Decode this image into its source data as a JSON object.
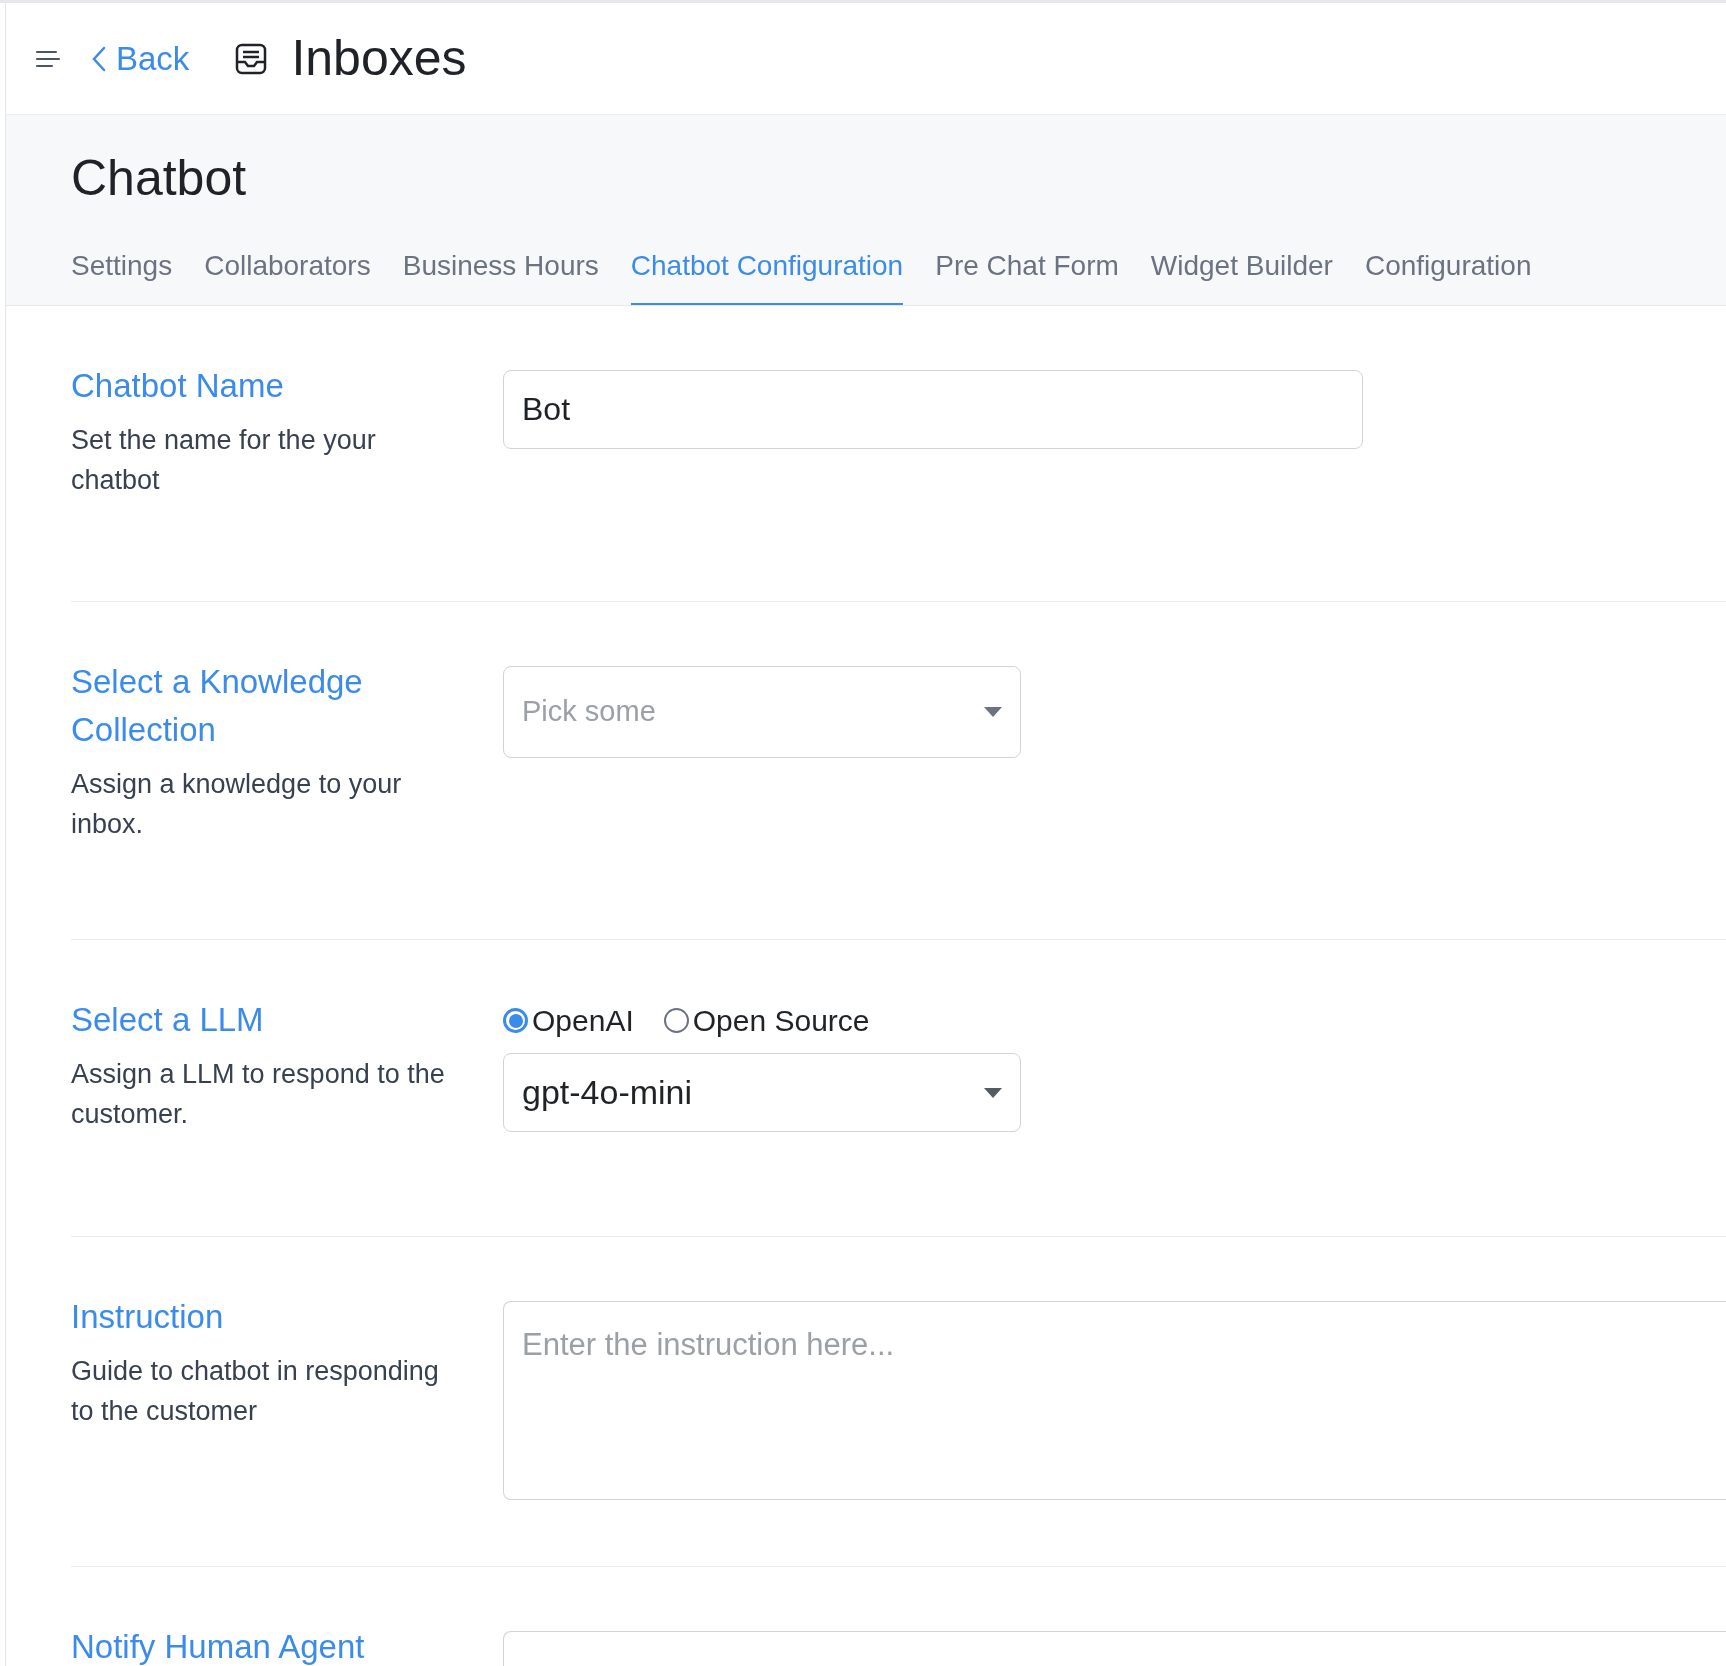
{
  "header": {
    "back": "Back",
    "title": "Inboxes"
  },
  "page": {
    "title": "Chatbot"
  },
  "tabs": [
    {
      "label": "Settings",
      "selected": false
    },
    {
      "label": "Collaborators",
      "selected": false
    },
    {
      "label": "Business Hours",
      "selected": false
    },
    {
      "label": "Chatbot Configuration",
      "selected": true
    },
    {
      "label": "Pre Chat Form",
      "selected": false
    },
    {
      "label": "Widget Builder",
      "selected": false
    },
    {
      "label": "Configuration",
      "selected": false
    }
  ],
  "sections": [
    {
      "kind": "text",
      "title": "Chatbot Name",
      "description": "Set the name for the your chatbot",
      "value": "Bot"
    },
    {
      "kind": "select",
      "title": "Select a Knowledge Collection",
      "description": "Assign a knowledge to your inbox.",
      "placeholder": "Pick some"
    },
    {
      "kind": "llm",
      "title": "Select a LLM",
      "description": "Assign a LLM to respond to the customer.",
      "options": [
        {
          "label": "OpenAI",
          "selected": true
        },
        {
          "label": "Open Source",
          "selected": false
        }
      ],
      "value": "gpt-4o-mini"
    },
    {
      "kind": "textarea",
      "title": "Instruction",
      "description": "Guide to chatbot in responding to the customer",
      "placeholder": "Enter the instruction here..."
    },
    {
      "kind": "textarea",
      "title": "Notify Human Agent"
    }
  ]
}
